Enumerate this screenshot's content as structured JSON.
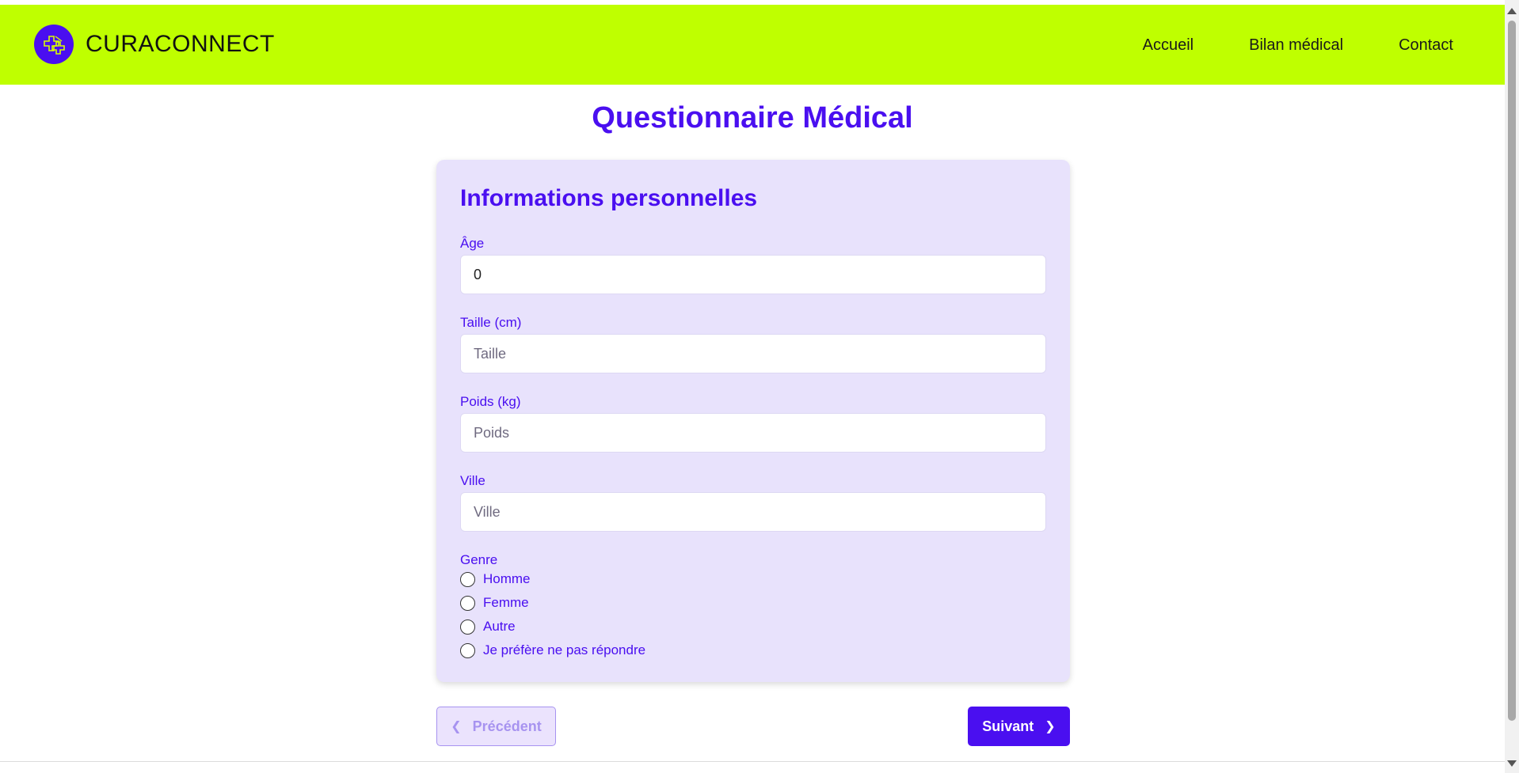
{
  "header": {
    "brand_name": "CURACONNECT",
    "nav": [
      {
        "label": "Accueil"
      },
      {
        "label": "Bilan médical"
      },
      {
        "label": "Contact"
      }
    ]
  },
  "page": {
    "title": "Questionnaire Médical"
  },
  "form": {
    "section_title": "Informations personnelles",
    "age": {
      "label": "Âge",
      "value": "0"
    },
    "height": {
      "label": "Taille (cm)",
      "placeholder": "Taille",
      "value": ""
    },
    "weight": {
      "label": "Poids (kg)",
      "placeholder": "Poids",
      "value": ""
    },
    "city": {
      "label": "Ville",
      "placeholder": "Ville",
      "value": ""
    },
    "gender": {
      "label": "Genre",
      "options": [
        {
          "label": "Homme",
          "selected": false
        },
        {
          "label": "Femme",
          "selected": false
        },
        {
          "label": "Autre",
          "selected": false
        },
        {
          "label": "Je préfère ne pas répondre",
          "selected": false
        }
      ]
    }
  },
  "buttons": {
    "previous": "Précédent",
    "next": "Suivant"
  },
  "colors": {
    "navbar": "#bfff00",
    "accent": "#4a0ff0",
    "card": "#e8e2fc",
    "disabled_button_text": "#a793f0"
  },
  "icons": {
    "logo": "medical-cross-logo-icon",
    "previous": "chevron-left-icon",
    "next": "chevron-right-icon"
  }
}
